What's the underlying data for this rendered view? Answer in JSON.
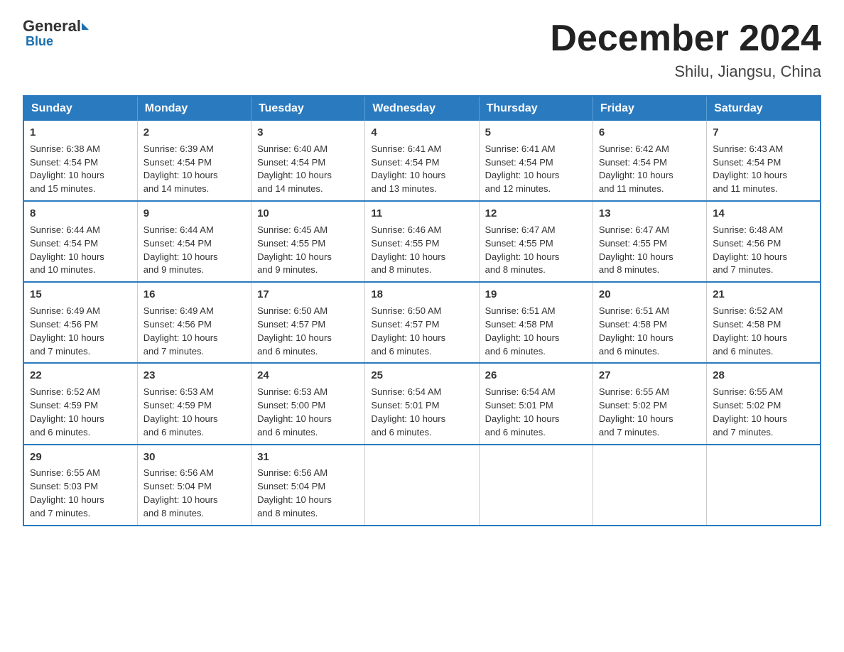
{
  "logo": {
    "general": "General",
    "blue": "Blue"
  },
  "header": {
    "month_year": "December 2024",
    "location": "Shilu, Jiangsu, China"
  },
  "weekdays": [
    "Sunday",
    "Monday",
    "Tuesday",
    "Wednesday",
    "Thursday",
    "Friday",
    "Saturday"
  ],
  "weeks": [
    [
      {
        "day": "1",
        "sunrise": "6:38 AM",
        "sunset": "4:54 PM",
        "daylight": "10 hours and 15 minutes."
      },
      {
        "day": "2",
        "sunrise": "6:39 AM",
        "sunset": "4:54 PM",
        "daylight": "10 hours and 14 minutes."
      },
      {
        "day": "3",
        "sunrise": "6:40 AM",
        "sunset": "4:54 PM",
        "daylight": "10 hours and 14 minutes."
      },
      {
        "day": "4",
        "sunrise": "6:41 AM",
        "sunset": "4:54 PM",
        "daylight": "10 hours and 13 minutes."
      },
      {
        "day": "5",
        "sunrise": "6:41 AM",
        "sunset": "4:54 PM",
        "daylight": "10 hours and 12 minutes."
      },
      {
        "day": "6",
        "sunrise": "6:42 AM",
        "sunset": "4:54 PM",
        "daylight": "10 hours and 11 minutes."
      },
      {
        "day": "7",
        "sunrise": "6:43 AM",
        "sunset": "4:54 PM",
        "daylight": "10 hours and 11 minutes."
      }
    ],
    [
      {
        "day": "8",
        "sunrise": "6:44 AM",
        "sunset": "4:54 PM",
        "daylight": "10 hours and 10 minutes."
      },
      {
        "day": "9",
        "sunrise": "6:44 AM",
        "sunset": "4:54 PM",
        "daylight": "10 hours and 9 minutes."
      },
      {
        "day": "10",
        "sunrise": "6:45 AM",
        "sunset": "4:55 PM",
        "daylight": "10 hours and 9 minutes."
      },
      {
        "day": "11",
        "sunrise": "6:46 AM",
        "sunset": "4:55 PM",
        "daylight": "10 hours and 8 minutes."
      },
      {
        "day": "12",
        "sunrise": "6:47 AM",
        "sunset": "4:55 PM",
        "daylight": "10 hours and 8 minutes."
      },
      {
        "day": "13",
        "sunrise": "6:47 AM",
        "sunset": "4:55 PM",
        "daylight": "10 hours and 8 minutes."
      },
      {
        "day": "14",
        "sunrise": "6:48 AM",
        "sunset": "4:56 PM",
        "daylight": "10 hours and 7 minutes."
      }
    ],
    [
      {
        "day": "15",
        "sunrise": "6:49 AM",
        "sunset": "4:56 PM",
        "daylight": "10 hours and 7 minutes."
      },
      {
        "day": "16",
        "sunrise": "6:49 AM",
        "sunset": "4:56 PM",
        "daylight": "10 hours and 7 minutes."
      },
      {
        "day": "17",
        "sunrise": "6:50 AM",
        "sunset": "4:57 PM",
        "daylight": "10 hours and 6 minutes."
      },
      {
        "day": "18",
        "sunrise": "6:50 AM",
        "sunset": "4:57 PM",
        "daylight": "10 hours and 6 minutes."
      },
      {
        "day": "19",
        "sunrise": "6:51 AM",
        "sunset": "4:58 PM",
        "daylight": "10 hours and 6 minutes."
      },
      {
        "day": "20",
        "sunrise": "6:51 AM",
        "sunset": "4:58 PM",
        "daylight": "10 hours and 6 minutes."
      },
      {
        "day": "21",
        "sunrise": "6:52 AM",
        "sunset": "4:58 PM",
        "daylight": "10 hours and 6 minutes."
      }
    ],
    [
      {
        "day": "22",
        "sunrise": "6:52 AM",
        "sunset": "4:59 PM",
        "daylight": "10 hours and 6 minutes."
      },
      {
        "day": "23",
        "sunrise": "6:53 AM",
        "sunset": "4:59 PM",
        "daylight": "10 hours and 6 minutes."
      },
      {
        "day": "24",
        "sunrise": "6:53 AM",
        "sunset": "5:00 PM",
        "daylight": "10 hours and 6 minutes."
      },
      {
        "day": "25",
        "sunrise": "6:54 AM",
        "sunset": "5:01 PM",
        "daylight": "10 hours and 6 minutes."
      },
      {
        "day": "26",
        "sunrise": "6:54 AM",
        "sunset": "5:01 PM",
        "daylight": "10 hours and 6 minutes."
      },
      {
        "day": "27",
        "sunrise": "6:55 AM",
        "sunset": "5:02 PM",
        "daylight": "10 hours and 7 minutes."
      },
      {
        "day": "28",
        "sunrise": "6:55 AM",
        "sunset": "5:02 PM",
        "daylight": "10 hours and 7 minutes."
      }
    ],
    [
      {
        "day": "29",
        "sunrise": "6:55 AM",
        "sunset": "5:03 PM",
        "daylight": "10 hours and 7 minutes."
      },
      {
        "day": "30",
        "sunrise": "6:56 AM",
        "sunset": "5:04 PM",
        "daylight": "10 hours and 8 minutes."
      },
      {
        "day": "31",
        "sunrise": "6:56 AM",
        "sunset": "5:04 PM",
        "daylight": "10 hours and 8 minutes."
      },
      null,
      null,
      null,
      null
    ]
  ],
  "labels": {
    "sunrise": "Sunrise:",
    "sunset": "Sunset:",
    "daylight": "Daylight:"
  }
}
